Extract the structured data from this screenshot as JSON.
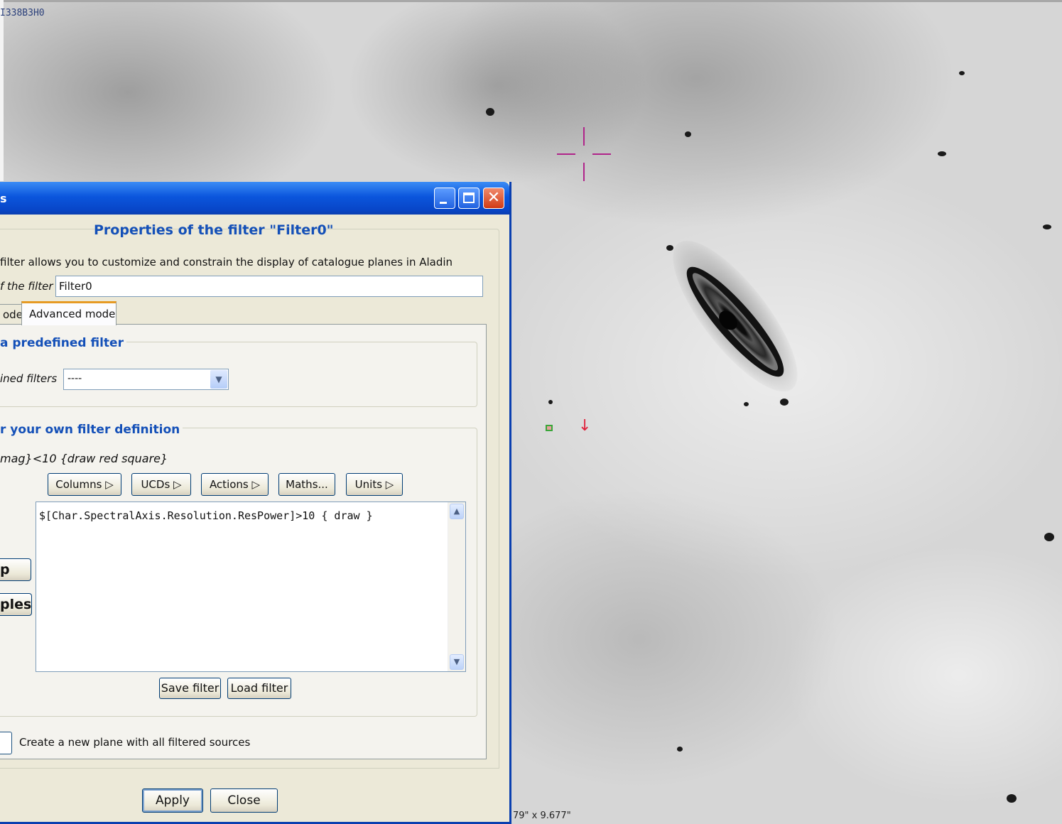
{
  "image": {
    "id_label": "I338B3H0",
    "scale_readout": "79\" x 9.677\""
  },
  "dialog": {
    "title": "s",
    "heading": "Properties of the filter \"Filter0\"",
    "intro": "filter allows you to customize and constrain the display of catalogue planes in Aladin",
    "name_label": "f the filter",
    "name_value": "Filter0",
    "tabs": [
      {
        "label": "ode",
        "selected": false
      },
      {
        "label": "Advanced mode",
        "selected": true
      }
    ],
    "predefined": {
      "title": "a predefined filter",
      "label": "ined filters",
      "selected_value": "----"
    },
    "own_definition": {
      "title": "r your own filter definition",
      "example": "mag}<10 {draw red square}",
      "menu_buttons": [
        "Columns ▷",
        "UCDs ▷",
        "Actions ▷",
        "Maths...",
        "Units ▷"
      ],
      "code": "$[Char.SpectralAxis.Resolution.ResPower]>10 { draw }",
      "side_buttons": [
        "p",
        "ples"
      ],
      "save_label": "Save filter",
      "load_label": "Load filter"
    },
    "checkbox_label": "Create a new plane with all filtered sources",
    "apply_label": "Apply",
    "close_label": "Close"
  },
  "colors": {
    "titlebar": "#0b56dd",
    "heading": "#1450b8",
    "tab_highlight": "#e69a23",
    "crosshair": "#b0248a",
    "marker_arrow": "#e0203a"
  },
  "icons": {
    "minimize": "minimize-icon",
    "maximize": "maximize-icon",
    "close": "close-icon",
    "dropdown": "chevron-down-icon",
    "scroll_up": "scroll-up-icon",
    "scroll_down": "scroll-down-icon"
  }
}
